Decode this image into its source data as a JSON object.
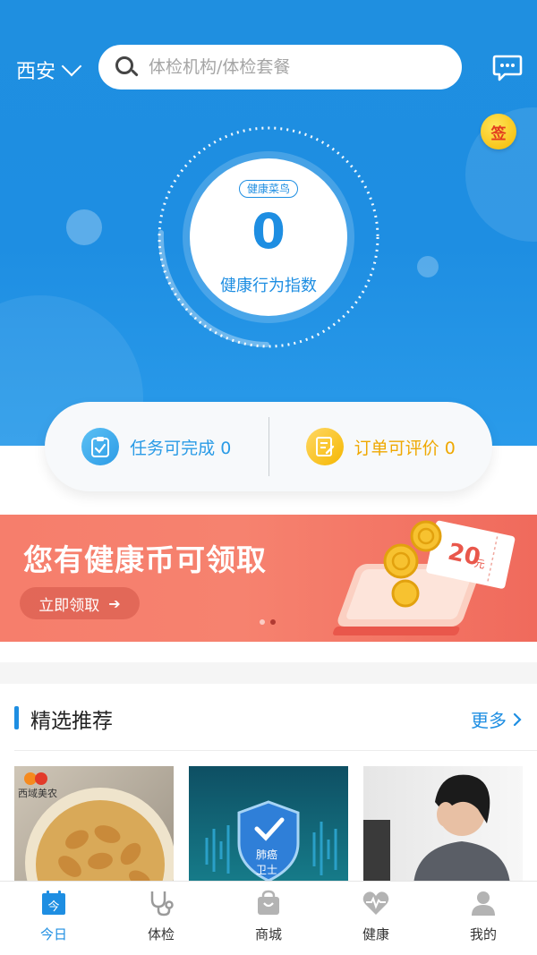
{
  "header": {
    "city": "西安",
    "search_placeholder": "体检机构/体检套餐",
    "sign_label": "签"
  },
  "health_index": {
    "level_tag": "健康菜鸟",
    "score": "0",
    "label": "健康行为指数"
  },
  "summary": {
    "tasks": "任务可完成 0",
    "orders": "订单可评价 0"
  },
  "banner": {
    "title": "您有健康币可领取",
    "button": "立即领取",
    "coupon_value": "20",
    "coupon_unit": "元",
    "coupon_label": "健康币",
    "active_slide": 2,
    "slide_count": 2
  },
  "recommend": {
    "title": "精选推荐",
    "more": "更多",
    "cards": [
      {
        "brand": "西域美农"
      },
      {
        "badge_line1": "肺癌",
        "badge_line2": "卫士"
      },
      {}
    ]
  },
  "tabs": [
    {
      "label": "今日",
      "icon": "calendar-icon",
      "glyph": "今",
      "active": true
    },
    {
      "label": "体检",
      "icon": "stethoscope-icon"
    },
    {
      "label": "商城",
      "icon": "shopping-bag-icon"
    },
    {
      "label": "健康",
      "icon": "heart-pulse-icon"
    },
    {
      "label": "我的",
      "icon": "user-icon"
    }
  ],
  "colors": {
    "primary": "#1e8ee2",
    "banner": "#f6826f",
    "task": "#2a9be6",
    "order": "#efa800"
  }
}
